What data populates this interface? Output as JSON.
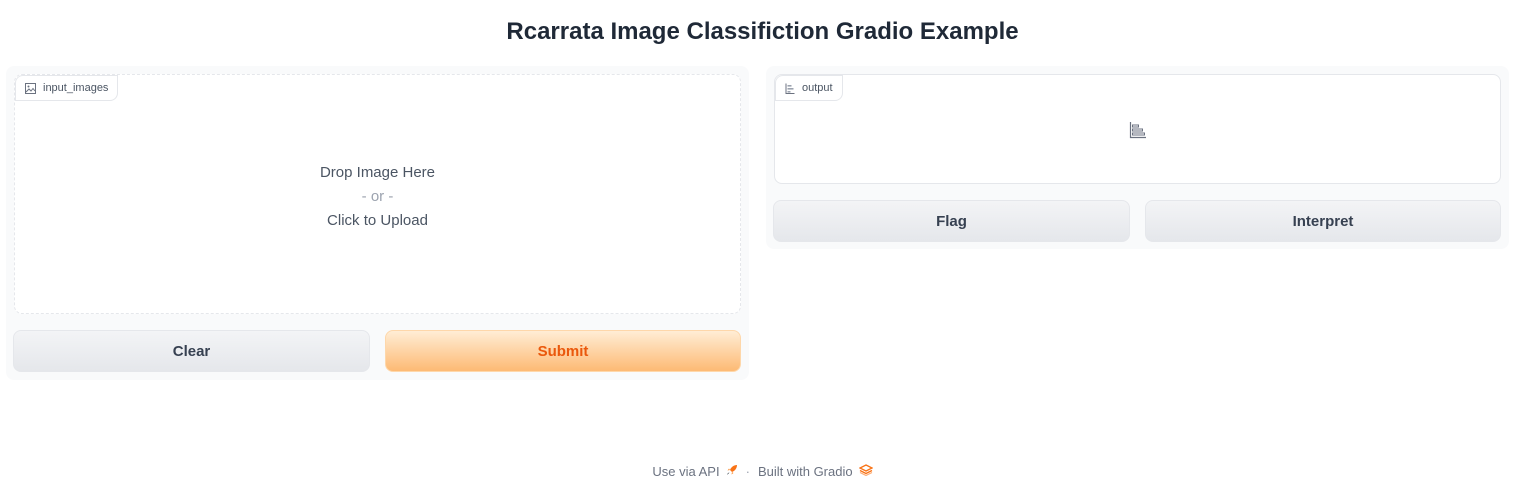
{
  "page": {
    "title": "Rcarrata Image Classifiction Gradio Example"
  },
  "input": {
    "label": "input_images",
    "label_icon": "image-icon",
    "drop_text": "Drop Image Here",
    "or_text": "- or -",
    "upload_text": "Click to Upload"
  },
  "output": {
    "label": "output",
    "label_icon": "bar-chart-icon",
    "placeholder_icon": "bar-chart-icon"
  },
  "buttons": {
    "clear": "Clear",
    "submit": "Submit",
    "flag": "Flag",
    "interpret": "Interpret"
  },
  "footer": {
    "api_link": "Use via API",
    "api_icon": "rocket-icon",
    "separator": "·",
    "built_with": "Built with Gradio",
    "gradio_icon": "gradio-logo-icon"
  },
  "colors": {
    "accent": "#ea580c",
    "submit_gradient_top": "#ffedd5",
    "submit_gradient_bottom": "#fdba74",
    "panel_bg": "#f9fafb",
    "border": "#e5e7eb"
  }
}
